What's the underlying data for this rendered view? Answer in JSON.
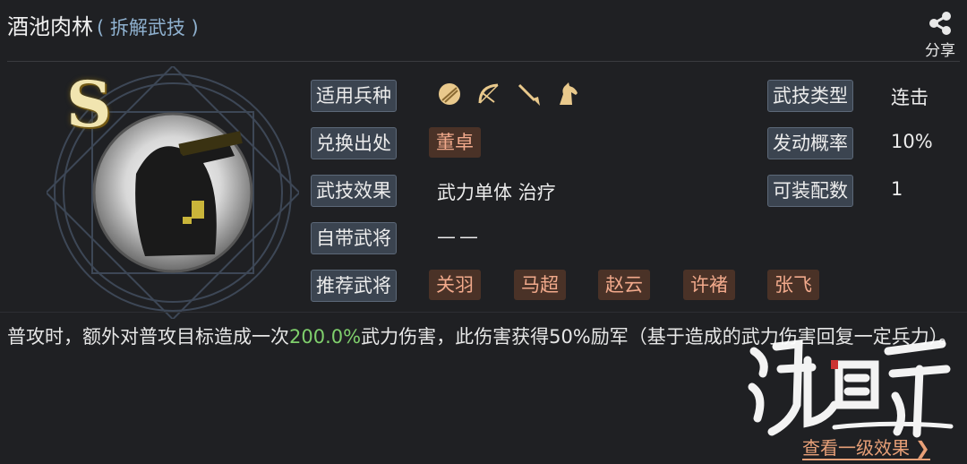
{
  "header": {
    "title": "酒池肉林",
    "subtitle": "( 拆解武技 )",
    "share_label": "分享"
  },
  "skill": {
    "grade": "S",
    "labels": {
      "troop_types": "适用兵种",
      "source": "兑换出处",
      "effect": "武技效果",
      "own_general": "自带武将",
      "recommended": "推荐武将",
      "skill_type": "武技类型",
      "trigger_rate": "发动概率",
      "equip_count": "可装配数"
    },
    "troop_icons": [
      "shield-icon",
      "bow-icon",
      "spear-icon",
      "horse-icon"
    ],
    "source": "董卓",
    "effect": "武力单体 治疗",
    "own_general": "——",
    "recommended_generals": [
      "关羽",
      "马超",
      "赵云",
      "许褚",
      "张飞"
    ],
    "skill_type": "连击",
    "trigger_rate": "10%",
    "equip_count": "1"
  },
  "description": {
    "part1": "普攻时，额外对普攻目标造成一次",
    "highlight": "200.0%",
    "part2": "武力伤害，此伤害获得50%励军（基于造成的武力伤害回复一定兵力）。",
    "highlight_color": "#7fcf6c"
  },
  "footer": {
    "view_level_one": "查看一级效果"
  },
  "colors": {
    "background": "#1f2023",
    "label_bg": "#3b4450",
    "chip_bg": "#4a3227",
    "chip_text": "#f1a98b",
    "link": "#e8a078"
  }
}
